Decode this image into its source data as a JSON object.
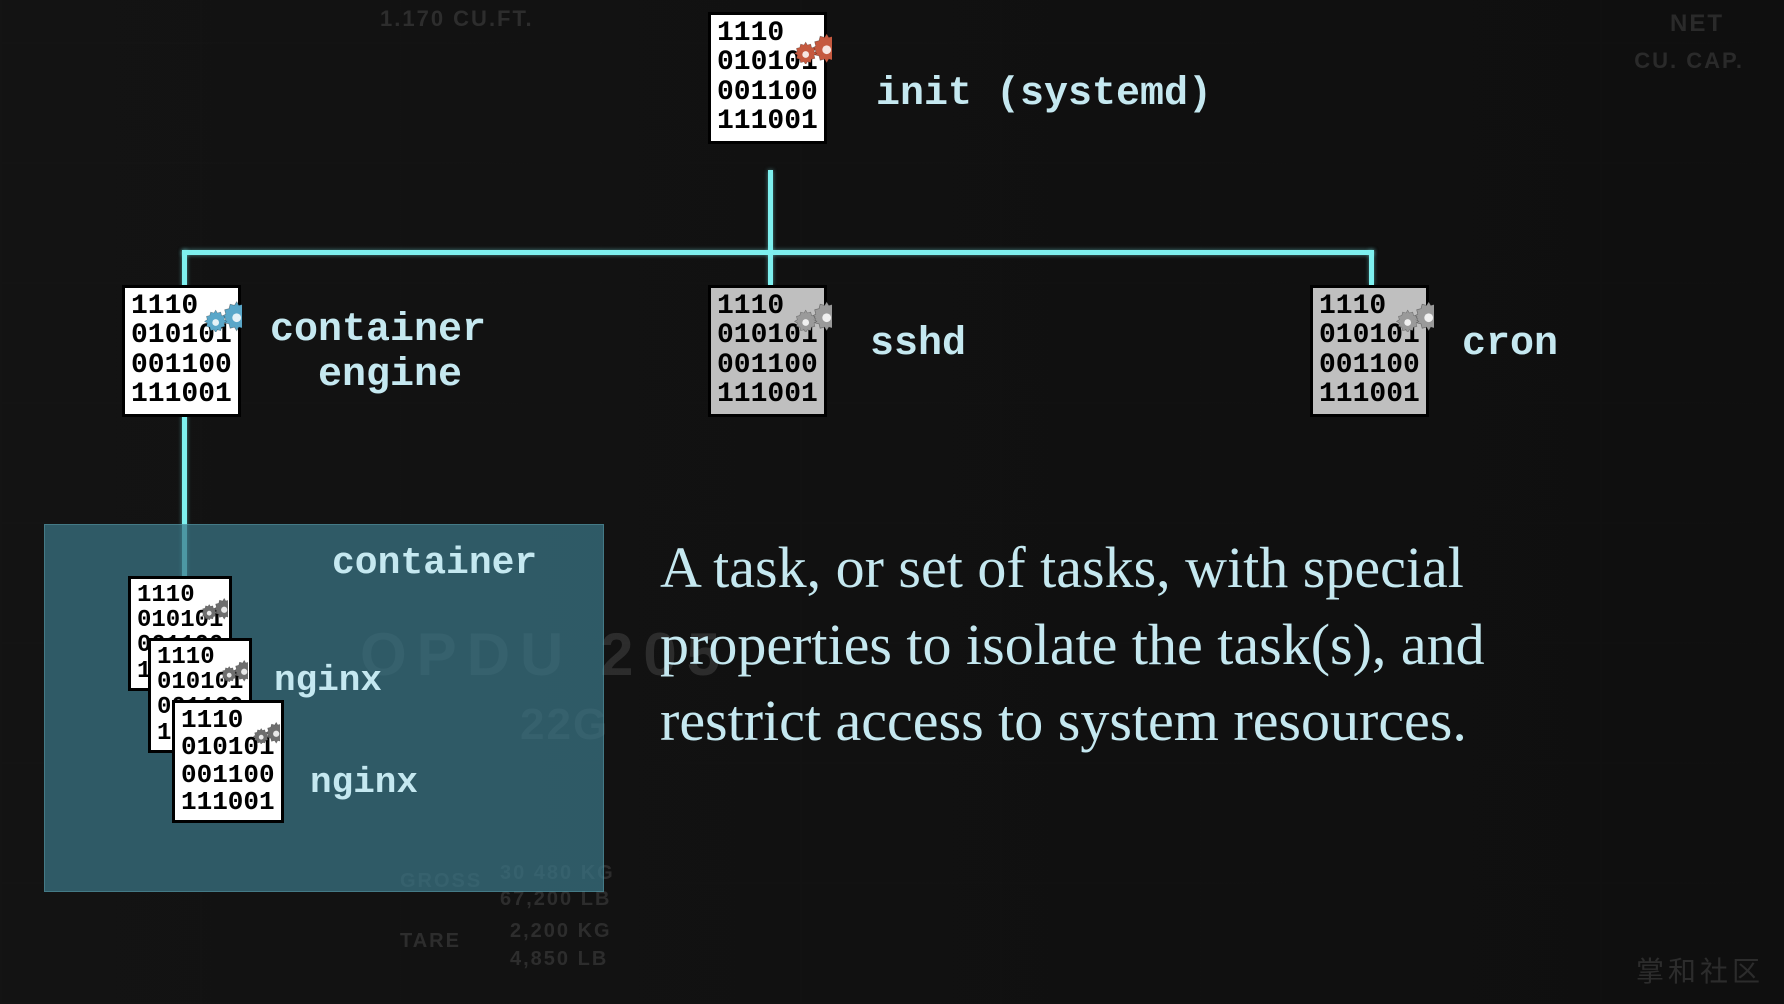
{
  "binary_pattern": "1110\n010101\n001100\n111001",
  "root": {
    "label": "init (systemd)",
    "gear_color": "#c5593f"
  },
  "children": [
    {
      "id": "container-engine",
      "label": "container\n  engine",
      "gear_color": "#5aa7c9"
    },
    {
      "id": "sshd",
      "label": "sshd",
      "gear_color": "#9a9a9a"
    },
    {
      "id": "cron",
      "label": "cron",
      "gear_color": "#9a9a9a"
    }
  ],
  "container": {
    "title": "container",
    "processes": [
      {
        "label": "",
        "gear_color": "#6e6e6e"
      },
      {
        "label": "nginx",
        "gear_color": "#6e6e6e"
      },
      {
        "label": "nginx",
        "gear_color": "#6e6e6e"
      }
    ]
  },
  "description": "A task, or set of tasks, with special properties to isolate the task(s), and restrict access to system resources.",
  "bg_labels": {
    "cuft": "1.170 CU.FT.",
    "net": "NET",
    "cucap": "CU. CAP.",
    "opdu": "OPDU  205",
    "gross": "GROSS",
    "tare": "TARE",
    "kg1": "30 480 KG",
    "lb1": "67,200 LB",
    "kg2": "2,200 KG",
    "lb2": "4,850 LB",
    "g22": "22G"
  },
  "watermark": "掌和社区"
}
